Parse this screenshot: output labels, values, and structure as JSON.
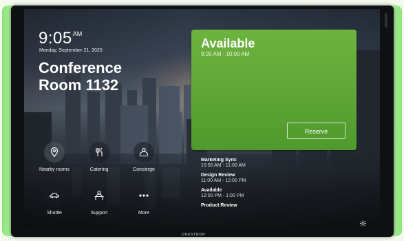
{
  "clock": {
    "time": "9:05",
    "ampm": "AM",
    "date": "Monday, September 21, 2020"
  },
  "room": {
    "line1": "Conference",
    "line2": "Room 1132"
  },
  "tiles": [
    {
      "label": "Nearby rooms",
      "icon": "location-pin-icon"
    },
    {
      "label": "Catering",
      "icon": "fork-knife-icon"
    },
    {
      "label": "Concierge",
      "icon": "concierge-bell-icon"
    },
    {
      "label": "Shuttle",
      "icon": "car-icon"
    },
    {
      "label": "Support",
      "icon": "support-person-icon"
    },
    {
      "label": "More",
      "icon": "more-dots-icon"
    }
  ],
  "status_card": {
    "status": "Available",
    "time_range": "9:00 AM - 10:00 AM",
    "reserve_label": "Reserve",
    "color": "#5da436"
  },
  "agenda": [
    {
      "title": "Marketing Sync",
      "time": "10:00 AM - 11:00 AM"
    },
    {
      "title": "Design Review",
      "time": "11:00 AM - 12:00 PM"
    },
    {
      "title": "Available",
      "time": "12:00 PM - 1:00 PM"
    },
    {
      "title": "Product Review",
      "time": ""
    }
  ],
  "brand": "CRESTRON",
  "icons": {
    "settings": "gear-icon"
  }
}
